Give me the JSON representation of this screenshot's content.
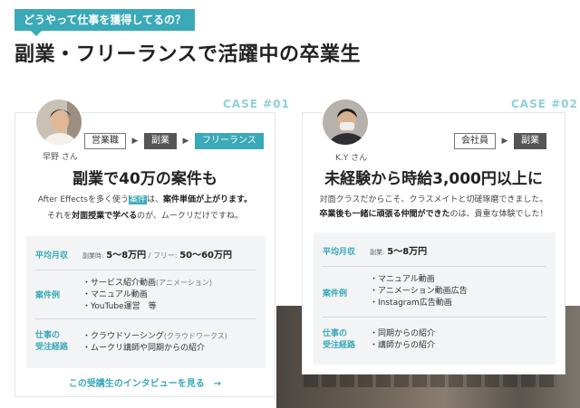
{
  "header": {
    "badge": "どうやって仕事を獲得してるの？",
    "title": "副業・フリーランスで活躍中の卒業生"
  },
  "cases": [
    {
      "label": "CASE #01",
      "name": "早野 さん",
      "flow": [
        "営業職",
        "副業",
        "フリーランス"
      ],
      "title": "副業で40万の案件も",
      "desc1_pre": "After Effectsを多く使う",
      "desc1_hl": "案件",
      "desc1_post": "は、",
      "desc1_bold": "案件単価が上がります。",
      "desc2_pre": "それを",
      "desc2_bold": "対面授業で学べる",
      "desc2_post": "のが、ムークリだけですね。",
      "income_label": "平均月収",
      "income_side_label": "副業時:",
      "income_side_value": "5〜8万円",
      "income_sep": " / フリー: ",
      "income_free_value": "50〜60万円",
      "examples_label": "案件例",
      "examples": [
        {
          "text": "・サービス紹介動画",
          "note": "(アニメーション)"
        },
        {
          "text": "・マニュアル動画",
          "note": ""
        },
        {
          "text": "・YouTube運営　等",
          "note": ""
        }
      ],
      "route_label_1": "仕事の",
      "route_label_2": "受注経路",
      "routes": [
        {
          "text": "・クラウドソーシング",
          "note": "(クラウドワークス)"
        },
        {
          "text": "・ムークリ講師や同期からの紹介",
          "note": ""
        }
      ],
      "link": "この受講生のインタビューを見る　→"
    },
    {
      "label": "CASE #02",
      "name": "K.Y さん",
      "flow": [
        "会社員",
        "副業"
      ],
      "title": "未経験から時給3,000円以上に",
      "desc1": "対面クラスだからこそ、クラスメイトと切磋琢磨できました。",
      "desc2_bold": "卒業後も一緒に頑張る仲間ができた",
      "desc2_post": "のは、貴重な体験でした！",
      "income_label": "平均月収",
      "income_side_label": "副業:",
      "income_side_value": "5〜8万円",
      "examples_label": "案件例",
      "examples": [
        {
          "text": "・マニュアル動画"
        },
        {
          "text": "・アニメーション動画広告"
        },
        {
          "text": "・Instagram広告動画"
        }
      ],
      "route_label_1": "仕事の",
      "route_label_2": "受注経路",
      "routes": [
        {
          "text": "・同期からの紹介"
        },
        {
          "text": "・講師からの紹介"
        }
      ]
    }
  ],
  "colors": {
    "accent": "#3aa9b8",
    "dark_tag": "#555555",
    "panel": "#f2f4f5"
  }
}
